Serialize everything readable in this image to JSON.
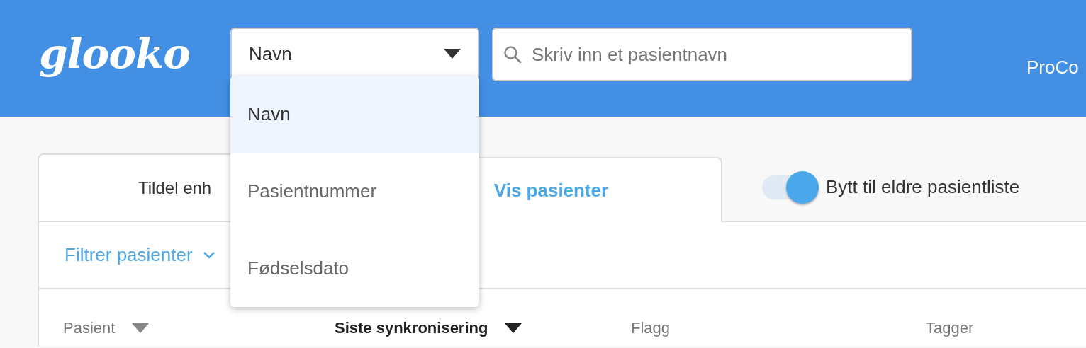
{
  "header": {
    "logo": "glooko",
    "search_type": {
      "value": "Navn",
      "expanded": true,
      "options": [
        {
          "label": "Navn",
          "selected": true
        },
        {
          "label": "Pasientnummer",
          "selected": false
        },
        {
          "label": "Fødselsdato",
          "selected": false
        }
      ]
    },
    "search": {
      "placeholder": "Skriv inn et pasientnavn"
    },
    "user": "ProCo"
  },
  "tabs": [
    {
      "label": "Tildel enh",
      "selected": false
    },
    {
      "label": "Vis pasienter",
      "selected": true
    }
  ],
  "legacy_toggle": {
    "label": "Bytt til eldre pasientliste",
    "on": true
  },
  "filter": {
    "label": "Filtrer pasienter"
  },
  "table": {
    "columns": [
      {
        "label": "Pasient",
        "sorted": false
      },
      {
        "label": "Siste synkronisering",
        "sorted": true
      },
      {
        "label": "Flagg"
      },
      {
        "label": "Tagger"
      }
    ]
  }
}
